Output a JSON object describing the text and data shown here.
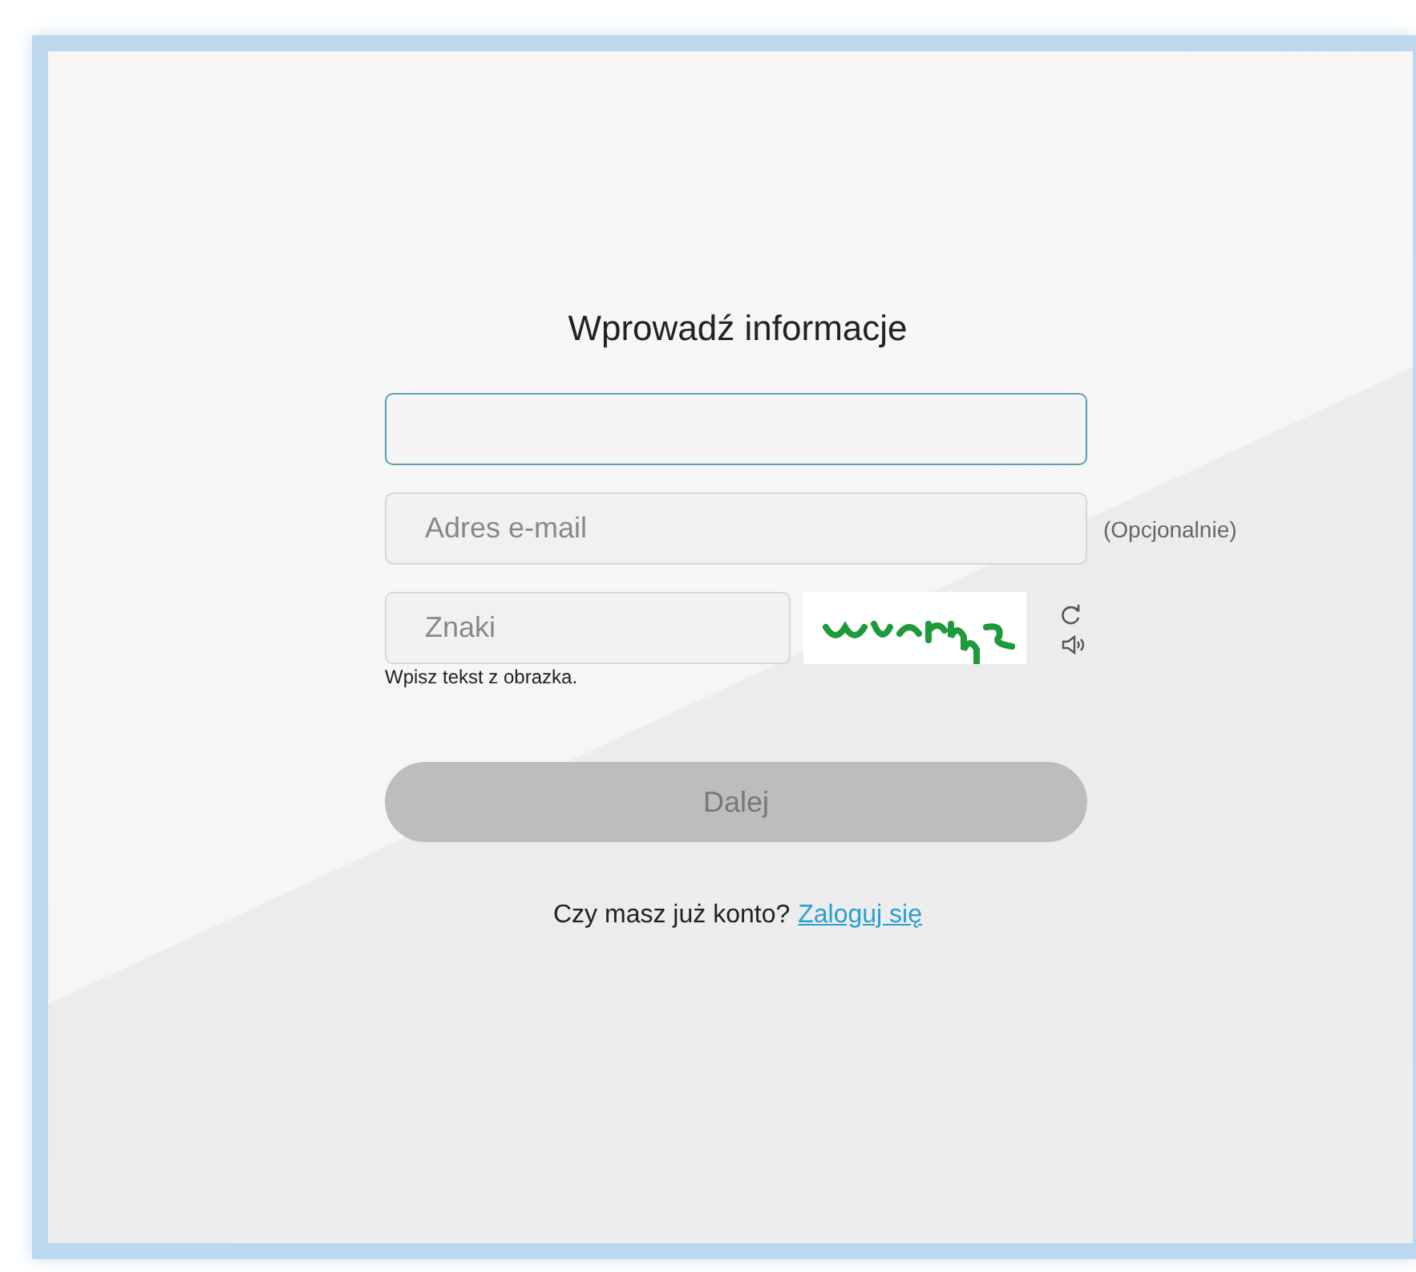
{
  "title": "Wprowadź informacje",
  "fields": [
    {
      "kind": "text",
      "focused": true
    },
    {
      "kind": "text",
      "placeholder": "Adres e-mail",
      "focused": false,
      "note": "(Opcjonalnie)"
    },
    {
      "kind": "captcha",
      "placeholder": "Znaki",
      "focused": false,
      "hint": "Wpisz tekst z obrazka."
    }
  ],
  "submit": {
    "label": "Dalej",
    "disabled": true
  },
  "footer": {
    "text": "Czy masz już konto?",
    "link": "Zaloguj się"
  }
}
